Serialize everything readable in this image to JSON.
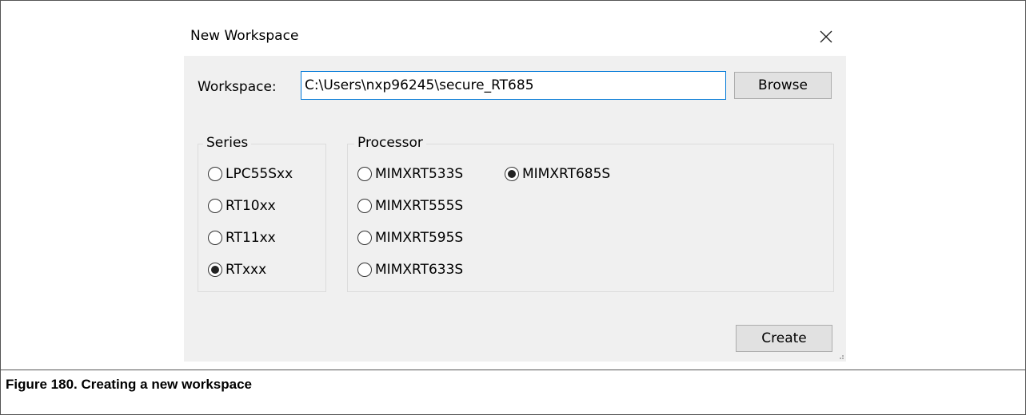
{
  "dialog": {
    "title": "New Workspace",
    "close_icon": "close-icon"
  },
  "workspace": {
    "label": "Workspace:",
    "value": "C:\\Users\\nxp96245\\secure_RT685",
    "browse_label": "Browse"
  },
  "series": {
    "legend": "Series",
    "options": [
      {
        "label": "LPC55Sxx",
        "selected": false
      },
      {
        "label": "RT10xx",
        "selected": false
      },
      {
        "label": "RT11xx",
        "selected": false
      },
      {
        "label": "RTxxx",
        "selected": true
      }
    ]
  },
  "processor": {
    "legend": "Processor",
    "options": [
      {
        "label": "MIMXRT533S",
        "selected": false
      },
      {
        "label": "MIMXRT685S",
        "selected": true
      },
      {
        "label": "MIMXRT555S",
        "selected": false
      },
      {
        "label": "MIMXRT595S",
        "selected": false
      },
      {
        "label": "MIMXRT633S",
        "selected": false
      }
    ]
  },
  "create_label": "Create",
  "caption": "Figure 180. Creating a new workspace",
  "colors": {
    "dialog_background": "#f0f0f0",
    "input_focus_border": "#0078d7",
    "button_face": "#e1e1e1"
  }
}
